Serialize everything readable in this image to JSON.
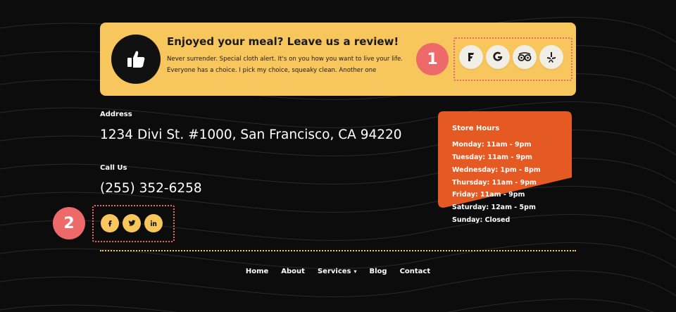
{
  "review": {
    "title": "Enjoyed your meal? Leave us a review!",
    "description": "Never surrender. Special cloth alert. It's on you how you want to live your life. Everyone has a choice. I pick my choice, squeaky clean. Another one",
    "icons": [
      "foursquare-icon",
      "google-icon",
      "tripadvisor-icon",
      "yelp-icon"
    ]
  },
  "badges": {
    "one": "1",
    "two": "2"
  },
  "contact": {
    "address_label": "Address",
    "address": "1234 Divi St. #1000, San Francisco, CA 94220",
    "call_label": "Call Us",
    "phone": "(255) 352-6258"
  },
  "social": [
    "facebook-icon",
    "twitter-icon",
    "linkedin-icon"
  ],
  "hours": {
    "title": "Store Hours",
    "lines": [
      "Monday: 11am - 9pm",
      "Tuesday: 11am - 9pm",
      "Wednesday: 1pm - 8pm",
      "Thursday: 11am - 9pm",
      "Friday: 11am - 9pm",
      "Saturday: 12am - 5pm",
      "Sunday: Closed"
    ]
  },
  "nav": {
    "home": "Home",
    "about": "About",
    "services": "Services",
    "blog": "Blog",
    "contact": "Contact"
  },
  "colors": {
    "background": "#0c0c0c",
    "accent_yellow": "#f7c65c",
    "hours_orange": "#e55a22",
    "badge_red": "#ee6a6a"
  }
}
